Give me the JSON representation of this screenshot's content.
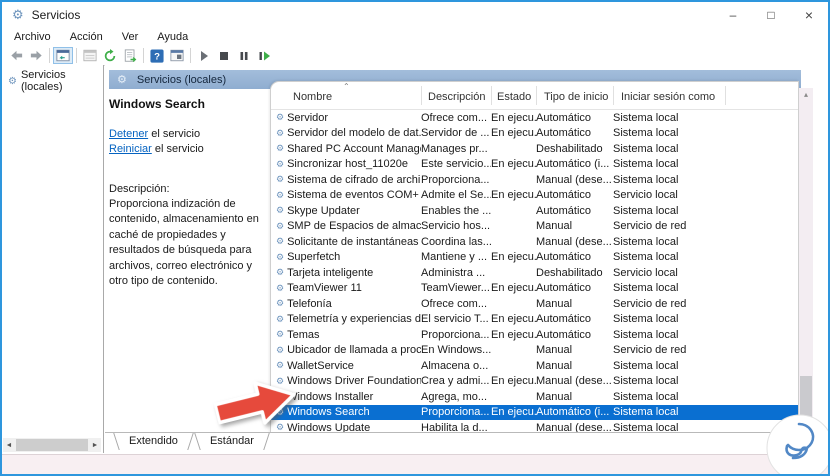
{
  "window": {
    "title": "Servicios",
    "controls": {
      "minimize": "–",
      "maximize": "□",
      "close": "×"
    }
  },
  "menu": {
    "items": [
      "Archivo",
      "Acción",
      "Ver",
      "Ayuda"
    ]
  },
  "left_pane": {
    "root_item": "Servicios (locales)"
  },
  "panel": {
    "header": "Servicios (locales)",
    "selected_service": {
      "name": "Windows Search",
      "stop_link": "Detener",
      "stop_rest": " el servicio",
      "restart_link": "Reiniciar",
      "restart_rest": " el servicio",
      "description_label": "Descripción:",
      "description": "Proporciona indización de contenido, almacenamiento en caché de propiedades y resultados de búsqueda para archivos, correo electrónico y otro tipo de contenido."
    },
    "tabs": [
      {
        "label": "Extendido",
        "active": true
      },
      {
        "label": "Estándar",
        "active": false
      }
    ]
  },
  "table": {
    "columns": [
      "Nombre",
      "Descripción",
      "Estado",
      "Tipo de inicio",
      "Iniciar sesión como"
    ],
    "rows": [
      {
        "name": "Servidor",
        "desc": "Ofrece com...",
        "status": "En ejecu...",
        "startup": "Automático",
        "logon": "Sistema local",
        "selected": false
      },
      {
        "name": "Servidor del modelo de dat...",
        "desc": "Servidor de ...",
        "status": "En ejecu...",
        "startup": "Automático",
        "logon": "Sistema local",
        "selected": false
      },
      {
        "name": "Shared PC Account Manager",
        "desc": "Manages pr...",
        "status": "",
        "startup": "Deshabilitado",
        "logon": "Sistema local",
        "selected": false
      },
      {
        "name": "Sincronizar host_11020e",
        "desc": "Este servicio...",
        "status": "En ejecu...",
        "startup": "Automático (i...",
        "logon": "Sistema local",
        "selected": false
      },
      {
        "name": "Sistema de cifrado de archi...",
        "desc": "Proporciona...",
        "status": "",
        "startup": "Manual (dese...",
        "logon": "Sistema local",
        "selected": false
      },
      {
        "name": "Sistema de eventos COM+",
        "desc": "Admite el Se...",
        "status": "En ejecu...",
        "startup": "Automático",
        "logon": "Servicio local",
        "selected": false
      },
      {
        "name": "Skype Updater",
        "desc": "Enables the ...",
        "status": "",
        "startup": "Automático",
        "logon": "Sistema local",
        "selected": false
      },
      {
        "name": "SMP de Espacios de almace...",
        "desc": "Servicio hos...",
        "status": "",
        "startup": "Manual",
        "logon": "Servicio de red",
        "selected": false
      },
      {
        "name": "Solicitante de instantáneas ...",
        "desc": "Coordina las...",
        "status": "",
        "startup": "Manual (dese...",
        "logon": "Sistema local",
        "selected": false
      },
      {
        "name": "Superfetch",
        "desc": "Mantiene y ...",
        "status": "En ejecu...",
        "startup": "Automático",
        "logon": "Sistema local",
        "selected": false
      },
      {
        "name": "Tarjeta inteligente",
        "desc": "Administra ...",
        "status": "",
        "startup": "Deshabilitado",
        "logon": "Servicio local",
        "selected": false
      },
      {
        "name": "TeamViewer 11",
        "desc": "TeamViewer...",
        "status": "En ejecu...",
        "startup": "Automático",
        "logon": "Sistema local",
        "selected": false
      },
      {
        "name": "Telefonía",
        "desc": "Ofrece com...",
        "status": "",
        "startup": "Manual",
        "logon": "Servicio de red",
        "selected": false
      },
      {
        "name": "Telemetría y experiencias de...",
        "desc": "El servicio T...",
        "status": "En ejecu...",
        "startup": "Automático",
        "logon": "Sistema local",
        "selected": false
      },
      {
        "name": "Temas",
        "desc": "Proporciona...",
        "status": "En ejecu...",
        "startup": "Automático",
        "logon": "Sistema local",
        "selected": false
      },
      {
        "name": "Ubicador de llamada a proc...",
        "desc": "En Windows...",
        "status": "",
        "startup": "Manual",
        "logon": "Servicio de red",
        "selected": false
      },
      {
        "name": "WalletService",
        "desc": "Almacena o...",
        "status": "",
        "startup": "Manual",
        "logon": "Sistema local",
        "selected": false
      },
      {
        "name": "Windows Driver Foundation...",
        "desc": "Crea y admi...",
        "status": "En ejecu...",
        "startup": "Manual (dese...",
        "logon": "Sistema local",
        "selected": false
      },
      {
        "name": "Windows Installer",
        "desc": "Agrega, mo...",
        "status": "",
        "startup": "Manual",
        "logon": "Sistema local",
        "selected": false
      },
      {
        "name": "Windows Search",
        "desc": "Proporciona...",
        "status": "En ejecu...",
        "startup": "Automático (i...",
        "logon": "Sistema local",
        "selected": true
      },
      {
        "name": "Windows Update",
        "desc": "Habilita la d...",
        "status": "",
        "startup": "Manual (dese...",
        "logon": "Sistema local",
        "selected": false
      }
    ]
  },
  "colors": {
    "selection": "#0a6fd1",
    "panel_header": "#97b3d6",
    "link": "#0563c1",
    "arrow_red": "#e64a3c",
    "screen_border": "#2e96dd",
    "logo_blue": "#5288c6"
  }
}
